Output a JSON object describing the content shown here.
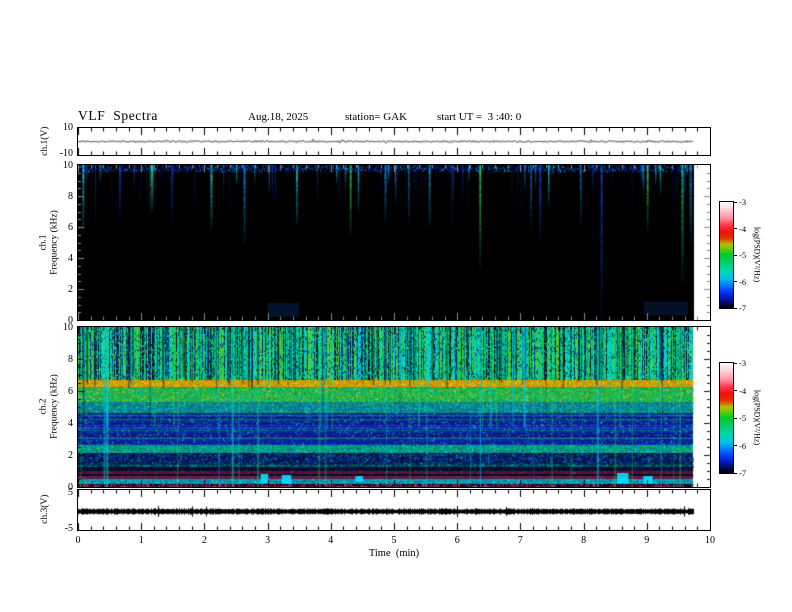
{
  "header": {
    "title": "VLF  Spectra",
    "date": "Aug.18, 2025",
    "station": "station= GAK",
    "start_ut": "start UT =  3 :40: 0"
  },
  "chart_data": {
    "type": "heatmap",
    "title": "VLF Spectra",
    "x_axis": {
      "label": "Time  (min)",
      "min": 0,
      "max": 10,
      "ticks": [
        0,
        1,
        2,
        3,
        4,
        5,
        6,
        7,
        8,
        9,
        10
      ],
      "minor_tick_step_min": 0.2,
      "data_end_min": 9.73
    },
    "panels": [
      {
        "id": "ch1-voltage",
        "ylabel": "ch.1(V)",
        "type": "line",
        "y_range": [
          -10,
          10
        ],
        "y_ticks": [
          10,
          -10
        ],
        "description": "low-amplitude noise trace near 0 V with sparse small spikes"
      },
      {
        "id": "ch1-spectrogram",
        "ylabel_lines": [
          "ch.1",
          "Frequency (kHz)"
        ],
        "type": "heatmap",
        "f_range_khz": [
          0,
          10
        ],
        "y_ticks": [
          0,
          2,
          4,
          6,
          8,
          10
        ],
        "background": "#000000",
        "sferic_band_khz": [
          6,
          10
        ],
        "events": [
          {
            "t": 0.07,
            "color": "#00e5ff",
            "depth": 0.45
          },
          {
            "t": 0.65,
            "color": "#0d47ff",
            "depth": 0.35
          },
          {
            "t": 1.15,
            "color": "#33ee66",
            "depth": 0.3
          },
          {
            "t": 2.1,
            "color": "#33ee66",
            "depth": 0.42
          },
          {
            "t": 2.62,
            "color": "#00aaff",
            "depth": 0.5
          },
          {
            "t": 3.45,
            "color": "#00e5ff",
            "depth": 0.38
          },
          {
            "t": 4.3,
            "color": "#33ee66",
            "depth": 0.45
          },
          {
            "t": 4.85,
            "color": "#00aaff",
            "depth": 0.36
          },
          {
            "t": 5.55,
            "color": "#00aaff",
            "depth": 0.4
          },
          {
            "t": 6.35,
            "color": "#33ee66",
            "depth": 0.66
          },
          {
            "t": 7.3,
            "color": "#0d55ff",
            "depth": 0.5
          },
          {
            "t": 8.27,
            "color": "#0d47ff",
            "depth": 1.0
          },
          {
            "t": 9.0,
            "color": "#33ee66",
            "depth": 0.42
          },
          {
            "t": 9.55,
            "color": "#00ee88",
            "depth": 0.75
          },
          {
            "t": 9.68,
            "color": "#00aaff",
            "depth": 0.5
          }
        ],
        "smudges": [
          {
            "t": 3.25,
            "f_lo": 0.2,
            "f_hi": 1.1,
            "dt": 0.5,
            "color": "#0a2459"
          },
          {
            "t": 9.3,
            "f_lo": 0.3,
            "f_hi": 1.2,
            "dt": 0.7,
            "color": "#0a1f4d"
          }
        ]
      },
      {
        "id": "ch2-spectrogram",
        "ylabel_lines": [
          "ch.2",
          "Frequency (kHz)"
        ],
        "type": "heatmap",
        "f_range_khz": [
          0,
          10
        ],
        "y_ticks": [
          0,
          2,
          4,
          6,
          8,
          10
        ],
        "bands": [
          {
            "f_hi": 10.0,
            "f_lo": 6.7,
            "style": "vstripes",
            "colors": [
              "#00cc77",
              "#22cc44",
              "#00bb99",
              "#00ccee",
              "#44cc33",
              "#00ddaa",
              "#001a4d",
              "#000d26",
              "#0a3d66",
              "#66cc22",
              "#00e5cc",
              "#003380"
            ]
          },
          {
            "f_hi": 6.7,
            "f_lo": 6.25,
            "style": "speckle",
            "colors": [
              "#cc9900",
              "#ffd700",
              "#ffaa00",
              "#ff8800",
              "#ffcc33",
              "#ff4400",
              "#aacc00",
              "#33bb44"
            ]
          },
          {
            "f_hi": 6.25,
            "f_lo": 5.3,
            "style": "speckle",
            "colors": [
              "#22aa44",
              "#33cc33",
              "#00cc66",
              "#55dd22",
              "#00ddbb",
              "#118833",
              "#00bbee",
              "#ffcc00"
            ]
          },
          {
            "f_hi": 5.3,
            "f_lo": 4.6,
            "style": "speckle",
            "colors": [
              "#0d7a8c",
              "#00aa77",
              "#00ccaa",
              "#1177aa",
              "#00ddcc",
              "#0a4d99",
              "#33cc55"
            ]
          },
          {
            "f_hi": 4.6,
            "f_lo": 2.65,
            "style": "hstripes",
            "base": "#0a1f8c",
            "rows": [
              "#0d2aa6",
              "#071457",
              "#123dcc",
              "#050d3a"
            ],
            "dots": [
              "#00aaff",
              "#00e5ff",
              "#33cc88"
            ],
            "lines": [
              "#2a5cff",
              "#00bb99"
            ]
          },
          {
            "f_hi": 2.65,
            "f_lo": 2.15,
            "style": "speckle",
            "colors": [
              "#00997a",
              "#00cc88",
              "#00ddee",
              "#33cc44",
              "#0d66cc",
              "#0a3d80"
            ]
          },
          {
            "f_hi": 2.15,
            "f_lo": 1.45,
            "style": "speckle",
            "colors": [
              "#001447",
              "#0a2980",
              "#0d3dcc",
              "#001026",
              "#0d55cc",
              "#00aacc"
            ]
          },
          {
            "f_hi": 1.45,
            "f_lo": 1.25,
            "style": "speckle",
            "colors": [
              "#003344",
              "#00bb88",
              "#00aacc",
              "#116644",
              "#0d2980"
            ]
          },
          {
            "f_hi": 1.25,
            "f_lo": 1.0,
            "style": "speckle",
            "colors": [
              "#000d33",
              "#0a1f66",
              "#000820",
              "#0d2980"
            ]
          },
          {
            "f_hi": 1.0,
            "f_lo": 0.82,
            "style": "solid",
            "base": "#5c0f26",
            "dots": [
              "#33bb44",
              "#cc2233"
            ]
          },
          {
            "f_hi": 0.82,
            "f_lo": 0.66,
            "style": "speckle",
            "colors": [
              "#000d33",
              "#0a1f66",
              "#001447"
            ]
          },
          {
            "f_hi": 0.66,
            "f_lo": 0.5,
            "style": "solid",
            "base": "#661a40",
            "dots": [
              "#22aa44"
            ]
          },
          {
            "f_hi": 0.5,
            "f_lo": 0.2,
            "style": "speckle",
            "colors": [
              "#0d8ca6",
              "#00ccaa",
              "#00ddee",
              "#33cc66",
              "#1177cc",
              "#0d4d99",
              "#00e5ff"
            ]
          },
          {
            "f_hi": 0.2,
            "f_lo": 0.0,
            "style": "speckle",
            "colors": [
              "#260011",
              "#cc2288",
              "#ee44aa",
              "#990a44",
              "#cc0033",
              "#0d4455",
              "#00bbcc",
              "#ff6699"
            ]
          }
        ],
        "patches": [
          {
            "t": 2.95,
            "f_lo": 0.25,
            "f_hi": 0.8,
            "dt": 0.12,
            "color": "#00e0ff"
          },
          {
            "t": 3.3,
            "f_lo": 0.2,
            "f_hi": 0.75,
            "dt": 0.15,
            "color": "#00e0ff"
          },
          {
            "t": 4.45,
            "f_lo": 0.3,
            "f_hi": 0.7,
            "dt": 0.12,
            "color": "#00e0ff"
          },
          {
            "t": 8.62,
            "f_lo": 0.2,
            "f_hi": 0.85,
            "dt": 0.18,
            "color": "#00e5ff"
          },
          {
            "t": 9.02,
            "f_lo": 0.2,
            "f_hi": 0.7,
            "dt": 0.15,
            "color": "#00e5ff"
          }
        ]
      },
      {
        "id": "ch3-voltage",
        "ylabel": "ch.3(V)",
        "type": "line",
        "y_range": [
          -5,
          5
        ],
        "y_ticks": [
          5,
          -5
        ],
        "description": "thick flat black trace near 0 V"
      }
    ],
    "colorbars": [
      {
        "label": "log(PSD)(V²/Hz)",
        "ticks": [
          -3,
          -4,
          -5,
          -6,
          -7
        ],
        "gradient": [
          [
            0,
            "#ffffff"
          ],
          [
            0.08,
            "#ffccd5"
          ],
          [
            0.16,
            "#ff8899"
          ],
          [
            0.22,
            "#ff3344"
          ],
          [
            0.28,
            "#f01010"
          ],
          [
            0.34,
            "#e03000"
          ],
          [
            0.4,
            "#bbbb00"
          ],
          [
            0.44,
            "#66cc00"
          ],
          [
            0.5,
            "#00c832"
          ],
          [
            0.58,
            "#00d070"
          ],
          [
            0.65,
            "#00d8b0"
          ],
          [
            0.72,
            "#00c0e8"
          ],
          [
            0.78,
            "#0080ff"
          ],
          [
            0.84,
            "#0040ff"
          ],
          [
            0.9,
            "#0018c0"
          ],
          [
            0.96,
            "#000850"
          ],
          [
            1,
            "#000000"
          ]
        ]
      },
      {
        "label": "log(PSD)(V²/Hz)",
        "ticks": [
          -3,
          -4,
          -5,
          -6,
          -7
        ],
        "gradient": [
          [
            0,
            "#ffffff"
          ],
          [
            0.08,
            "#ffccd5"
          ],
          [
            0.16,
            "#ff8899"
          ],
          [
            0.22,
            "#ff3344"
          ],
          [
            0.28,
            "#f01010"
          ],
          [
            0.34,
            "#e03000"
          ],
          [
            0.4,
            "#bbbb00"
          ],
          [
            0.44,
            "#66cc00"
          ],
          [
            0.5,
            "#00c832"
          ],
          [
            0.58,
            "#00d070"
          ],
          [
            0.65,
            "#00d8b0"
          ],
          [
            0.72,
            "#00c0e8"
          ],
          [
            0.78,
            "#0080ff"
          ],
          [
            0.84,
            "#0040ff"
          ],
          [
            0.9,
            "#0018c0"
          ],
          [
            0.96,
            "#000850"
          ],
          [
            1,
            "#000000"
          ]
        ]
      }
    ]
  }
}
